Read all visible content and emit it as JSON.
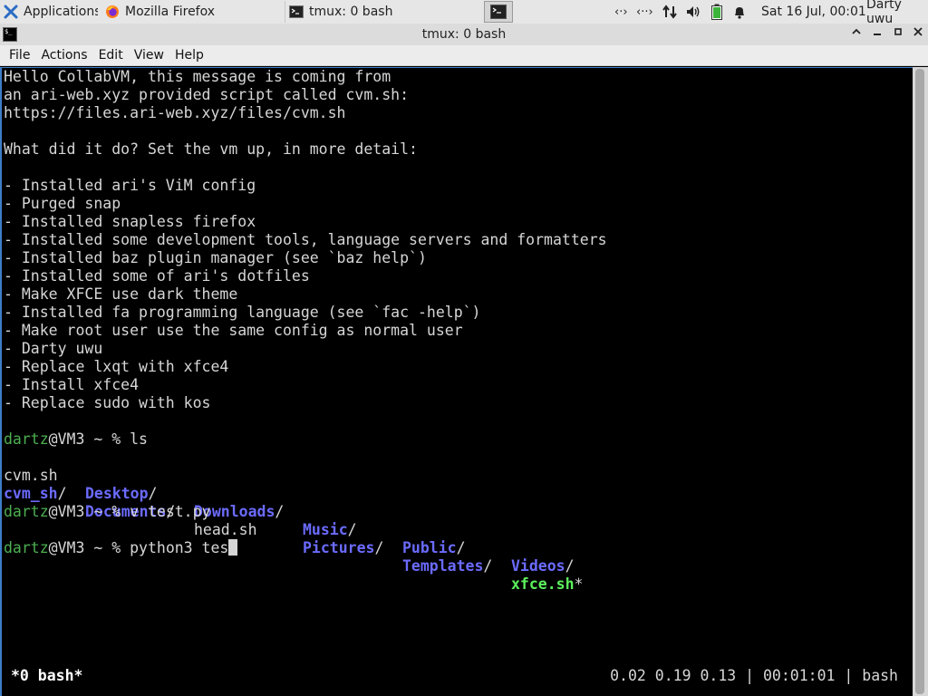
{
  "panel": {
    "applications_label": "Applications",
    "firefox_task": "Mozilla Firefox",
    "tmux_task": "tmux: 0 bash",
    "clock": "Sat 16 Jul, 00:01",
    "user": "Darty uwu",
    "network_icons": [
      "‹·›",
      "‹··›"
    ]
  },
  "window": {
    "title": "tmux: 0 bash",
    "controls": {
      "shade": "⌃",
      "minimize": "−",
      "maximize": "▫",
      "close": "✕"
    }
  },
  "menubar": [
    "File",
    "Actions",
    "Edit",
    "View",
    "Help"
  ],
  "terminal": {
    "lines": [
      "Hello CollabVM, this message is coming from",
      "an ari-web.xyz provided script called cvm.sh:",
      "https://files.ari-web.xyz/files/cvm.sh",
      "",
      "What did it do? Set the vm up, in more detail:",
      "",
      "- Installed ari's ViM config",
      "- Purged snap",
      "- Installed snapless firefox",
      "- Installed some development tools, language servers and formatters",
      "- Installed baz plugin manager (see `baz help`)",
      "- Installed some of ari's dotfiles",
      "- Make XFCE use dark theme",
      "- Installed fa programming language (see `fac -help`)",
      "- Make root user use the same config as normal user",
      "- Darty uwu",
      "- Replace lxqt with xfce4",
      "- Install xfce4",
      "- Replace sudo with kos"
    ],
    "prompt_user": "dartz",
    "prompt_rest": "@VM3 ~ % ",
    "cmd1": "ls",
    "ls": {
      "row1": [
        {
          "name": "cvm.sh",
          "kind": "file",
          "suffix": ""
        },
        {
          "name": "Desktop",
          "kind": "dir",
          "suffix": "/"
        },
        {
          "name": "Downloads",
          "kind": "dir",
          "suffix": "/"
        },
        {
          "name": "Music",
          "kind": "dir",
          "suffix": "/"
        },
        {
          "name": "Public",
          "kind": "dir",
          "suffix": "/"
        },
        {
          "name": "Videos",
          "kind": "dir",
          "suffix": "/"
        }
      ],
      "row2": [
        {
          "name": "cvm_sh",
          "kind": "dir",
          "suffix": "/"
        },
        {
          "name": "Documents",
          "kind": "dir",
          "suffix": "/"
        },
        {
          "name": "head.sh",
          "kind": "file",
          "suffix": ""
        },
        {
          "name": "Pictures",
          "kind": "dir",
          "suffix": "/"
        },
        {
          "name": "Templates",
          "kind": "dir",
          "suffix": "/"
        },
        {
          "name": "xfce.sh",
          "kind": "exe",
          "suffix": "*"
        }
      ]
    },
    "cmd2": "v test.py",
    "cmd3": "python3 tes"
  },
  "tmux_status": {
    "window": "*0 bash*",
    "right": "0.02 0.19 0.13 | 00:01:01 | bash"
  }
}
